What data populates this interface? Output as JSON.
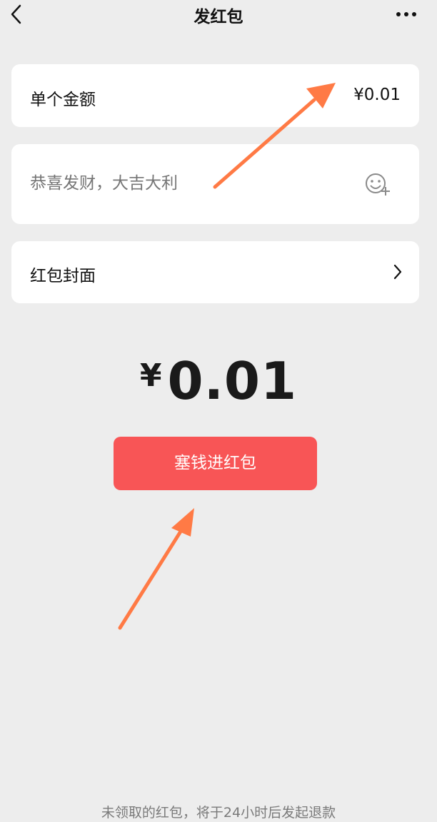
{
  "header": {
    "title": "发红包",
    "back_icon": "chevron-left-icon",
    "more_icon": "more-dots-icon"
  },
  "amount_row": {
    "label": "单个金额",
    "value": "¥0.01"
  },
  "greeting": {
    "placeholder": "恭喜发财，大吉大利",
    "emoji_icon": "emoji-add-icon"
  },
  "cover_row": {
    "label": "红包封面",
    "chevron_icon": "chevron-right-icon"
  },
  "total": {
    "currency": "¥",
    "amount": "0.01"
  },
  "pay_button": {
    "label": "塞钱进红包",
    "color": "#f85556"
  },
  "footer": {
    "note": "未领取的红包，将于24小时后发起退款"
  },
  "colors": {
    "background": "#ededed",
    "card": "#ffffff",
    "annotation_arrow": "#ff7a45"
  }
}
